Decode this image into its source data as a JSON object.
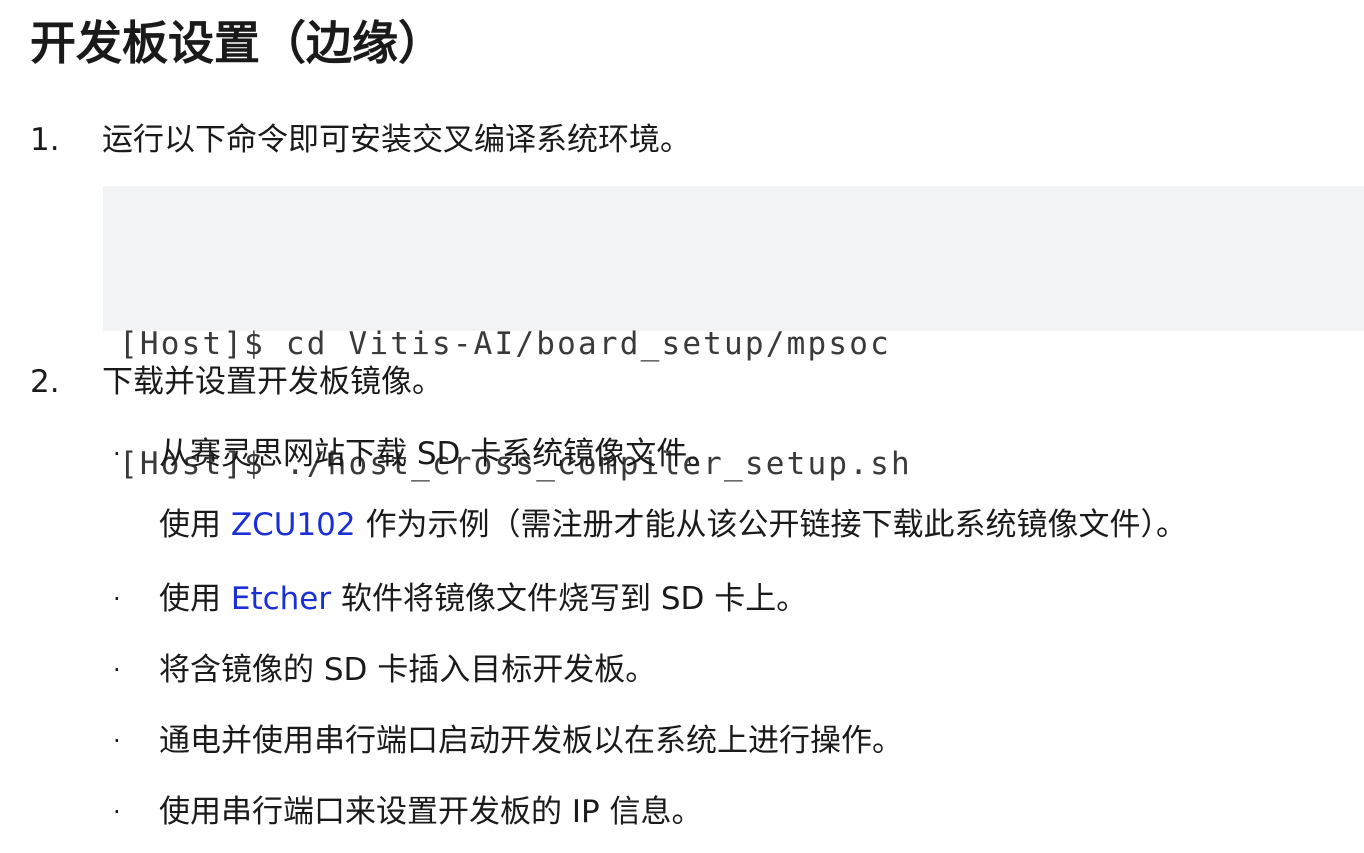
{
  "title": "开发板设置（边缘）",
  "steps": [
    {
      "number": "1.",
      "text": "运行以下命令即可安装交叉编译系统环境。"
    },
    {
      "number": "2.",
      "text": "下载并设置开发板镜像。"
    }
  ],
  "code": {
    "lines": [
      "[Host]$ cd Vitis-AI/board_setup/mpsoc",
      "[Host]$ ./host_cross_compiler_setup.sh"
    ]
  },
  "bullet_marker": "·",
  "bullets": {
    "b1": {
      "text": "从赛灵思网站下载 SD 卡系统镜像文件。"
    },
    "b1_sub": {
      "before": "使用 ",
      "link": "ZCU102",
      "after": " 作为示例（需注册才能从该公开链接下载此系统镜像文件）。"
    },
    "b2": {
      "before": "使用 ",
      "link": "Etcher",
      "after": " 软件将镜像文件烧写到 SD 卡上。"
    },
    "b3": {
      "text": "将含镜像的 SD 卡插入目标开发板。"
    },
    "b4": {
      "text": "通电并使用串行端口启动开发板以在系统上进行操作。"
    },
    "b5": {
      "text": "使用串行端口来设置开发板的 IP 信息。"
    }
  },
  "colors": {
    "link": "#1a2fd6",
    "code_background": "#f1f3f4",
    "text": "#1a1a1a"
  }
}
